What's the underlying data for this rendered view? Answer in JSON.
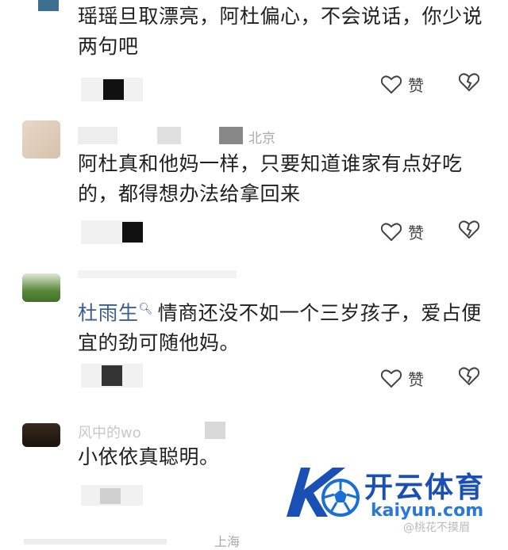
{
  "comments": [
    {
      "text": "瑶瑶旦取漂亮，阿杜偏心，不会说话，你少说两句吧",
      "like_label": "赞"
    },
    {
      "location": "北京",
      "text": "阿杜真和他妈一样，只要知道谁家有点好吃的，都得想办法给拿回来",
      "like_label": "赞"
    },
    {
      "mention": "杜雨生",
      "text": "情商还没不如一个三岁孩子，爱占便宜的劲可随他妈。",
      "like_label": "赞"
    },
    {
      "username_partial": "风中的wo",
      "text": "小依依真聪明。"
    },
    {
      "location": "上海"
    }
  ],
  "logo": {
    "brand_text": "开云体育",
    "url_text": "kaiyun.com",
    "mark_letter": "K"
  },
  "watermark": "@桃花不摸眉",
  "colors": {
    "mention": "#3b5f8f",
    "logo_primary": "#1a4fb4",
    "logo_secondary": "#2a79d6"
  },
  "icons": {
    "like": "heart-outline-icon",
    "dislike": "broken-heart-icon",
    "mention_marker": "search-small-icon"
  }
}
